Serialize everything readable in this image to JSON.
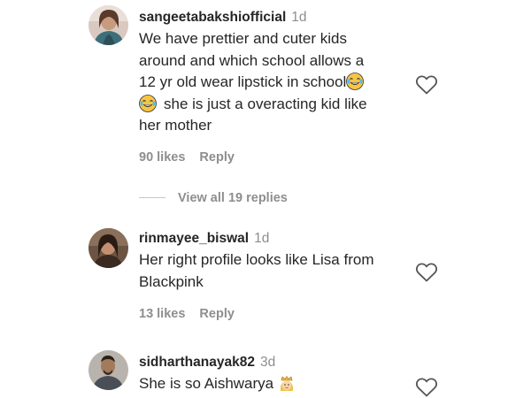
{
  "comments": [
    {
      "username": "sangeetabakshiofficial",
      "time": "1d",
      "lines": [
        "We have prettier and cuter kids",
        "around and which school allows a",
        "12 yr old wear lipstick in school",
        "she is just a overacting kid like",
        "her mother"
      ],
      "likes": "90 likes",
      "reply": "Reply",
      "view_replies": "View all 19 replies",
      "emojis": [
        "face-with-tears-of-joy",
        "face-with-tears-of-joy"
      ]
    },
    {
      "username": "rinmayee_biswal",
      "time": "1d",
      "lines": [
        "Her right profile looks like Lisa from",
        "Blackpink"
      ],
      "likes": "13 likes",
      "reply": "Reply"
    },
    {
      "username": "sidharthanayak82",
      "time": "3d",
      "lines": [
        "She is so Aishwarya"
      ],
      "emojis": [
        "princess"
      ]
    }
  ]
}
